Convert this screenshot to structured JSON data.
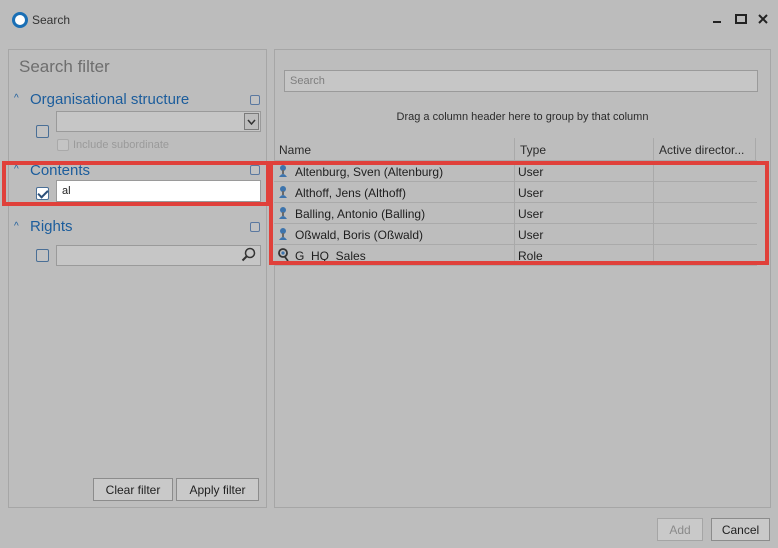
{
  "window": {
    "title": "Search"
  },
  "left_panel": {
    "title": "Search filter",
    "sections": {
      "org": {
        "label": "Organisational structure",
        "sub_label": "Include subordinate"
      },
      "contents": {
        "label": "Contents",
        "value": "al"
      },
      "rights": {
        "label": "Rights"
      }
    },
    "buttons": {
      "clear": "Clear filter",
      "apply": "Apply filter"
    }
  },
  "right_panel": {
    "search_placeholder": "Search",
    "group_hint": "Drag a column header here to group by that column",
    "columns": [
      "Name",
      "Type",
      "Active director..."
    ],
    "rows": [
      {
        "name": "Altenburg, Sven (Altenburg)",
        "type": "User",
        "icon": "user-icon"
      },
      {
        "name": "Althoff, Jens (Althoff)",
        "type": "User",
        "icon": "user-icon"
      },
      {
        "name": "Balling, Antonio (Balling)",
        "type": "User",
        "icon": "user-icon"
      },
      {
        "name": "Oßwald, Boris (Oßwald)",
        "type": "User",
        "icon": "user-icon"
      },
      {
        "name": "G_HQ_Sales",
        "type": "Role",
        "icon": "role-icon"
      }
    ]
  },
  "footer": {
    "add": "Add",
    "cancel": "Cancel"
  },
  "colors": {
    "accent": "#1c5d9c",
    "highlight": "#e0403a"
  }
}
